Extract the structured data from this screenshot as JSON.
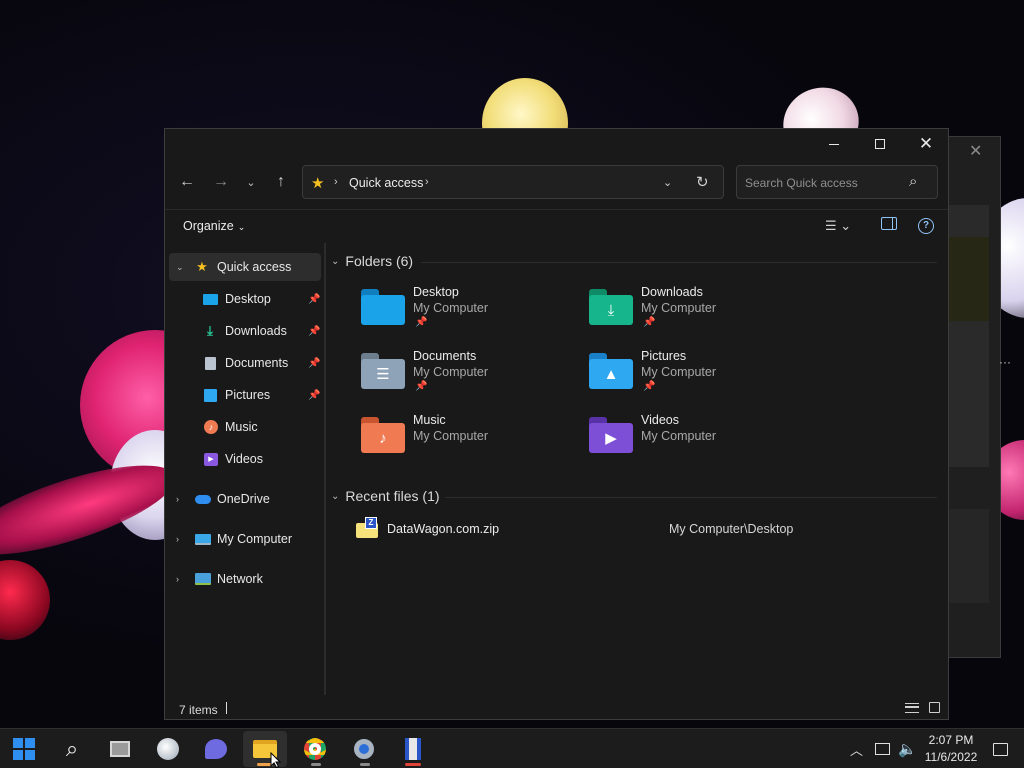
{
  "window": {
    "address": "Quick access",
    "search_placeholder": "Search Quick access",
    "organize_label": "Organize",
    "status": "7 items"
  },
  "nav": {
    "quick_access": "Quick access",
    "items": [
      {
        "label": "Desktop",
        "pinned": true,
        "icon": "desktop-icon"
      },
      {
        "label": "Downloads",
        "pinned": true,
        "icon": "downloads-icon"
      },
      {
        "label": "Documents",
        "pinned": true,
        "icon": "documents-icon"
      },
      {
        "label": "Pictures",
        "pinned": true,
        "icon": "pictures-icon"
      },
      {
        "label": "Music",
        "pinned": false,
        "icon": "music-icon"
      },
      {
        "label": "Videos",
        "pinned": false,
        "icon": "videos-icon"
      }
    ],
    "roots": [
      {
        "label": "OneDrive",
        "icon": "cloud-icon"
      },
      {
        "label": "My Computer",
        "icon": "computer-icon"
      },
      {
        "label": "Network",
        "icon": "network-icon"
      }
    ]
  },
  "content": {
    "folders_header": "Folders (6)",
    "folders": [
      {
        "name": "Desktop",
        "location": "My Computer",
        "pinned": true,
        "color": "#1aa3e8"
      },
      {
        "name": "Downloads",
        "location": "My Computer",
        "pinned": true,
        "color": "#17b58c"
      },
      {
        "name": "Documents",
        "location": "My Computer",
        "pinned": true,
        "color": "#8fa3b8"
      },
      {
        "name": "Pictures",
        "location": "My Computer",
        "pinned": true,
        "color": "#2ea8f0"
      },
      {
        "name": "Music",
        "location": "My Computer",
        "pinned": false,
        "color": "#f07a52"
      },
      {
        "name": "Videos",
        "location": "My Computer",
        "pinned": false,
        "color": "#7d4fd6"
      }
    ],
    "recent_header": "Recent files (1)",
    "recent": [
      {
        "name": "DataWagon.com.zip",
        "location": "My Computer\\Desktop"
      }
    ]
  },
  "taskbar": {
    "time": "2:07 PM",
    "date": "11/6/2022"
  },
  "colors": {
    "accent": "#2f8ff0",
    "star": "#f5c020",
    "window_bg": "#191919"
  }
}
